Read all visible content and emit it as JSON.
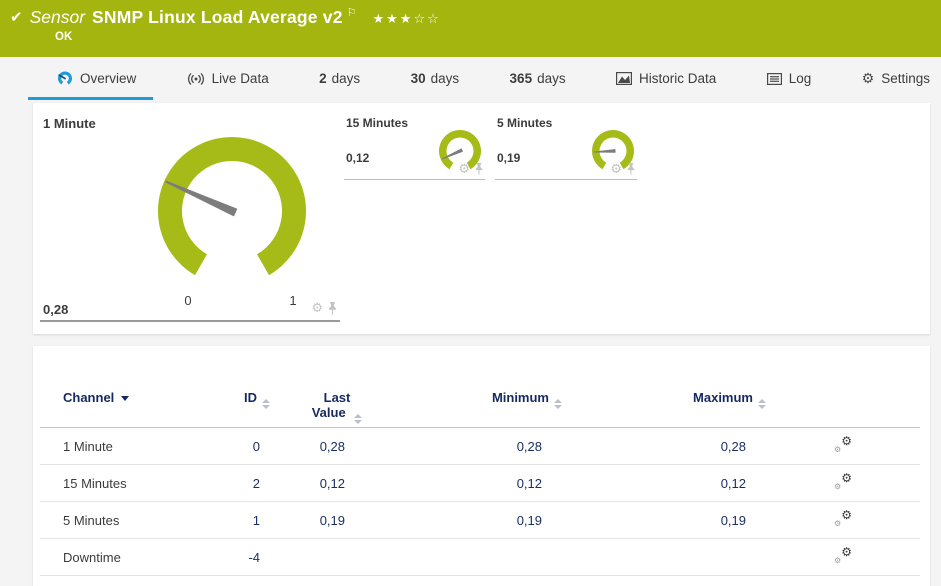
{
  "header": {
    "check_icon": "✔",
    "kind": "Sensor",
    "title": "SNMP Linux Load Average v2",
    "flag_icon": "⚐",
    "stars_filled": "★★★",
    "stars_empty": "☆☆",
    "status": "OK"
  },
  "tabs": {
    "overview": {
      "label": "Overview"
    },
    "live_data": {
      "label": "Live Data"
    },
    "days2": {
      "value": "2",
      "unit": "days"
    },
    "days30": {
      "value": "30",
      "unit": "days"
    },
    "days365": {
      "value": "365",
      "unit": "days"
    },
    "historic": {
      "label": "Historic Data"
    },
    "log": {
      "label": "Log"
    },
    "settings": {
      "label": "Settings"
    }
  },
  "icons": {
    "gear": "⚙"
  },
  "colors": {
    "brand_green": "#a3b50e",
    "gauge_green": "#a6bb17",
    "accent_blue": "#1e9cd9",
    "table_header_navy": "#16295f"
  },
  "gauges": {
    "primary": {
      "title": "1 Minute",
      "value": "0,28",
      "value_num": 0.28,
      "scale_min": "0",
      "scale_max": "1"
    },
    "mini1": {
      "title": "15 Minutes",
      "value": "0,12",
      "value_num": 0.12
    },
    "mini2": {
      "title": "5 Minutes",
      "value": "0,19",
      "value_num": 0.19
    }
  },
  "table": {
    "headers": {
      "channel": "Channel",
      "id": "ID",
      "last_value": "Last Value",
      "minimum": "Minimum",
      "maximum": "Maximum"
    },
    "rows": [
      {
        "channel": "1 Minute",
        "id": "0",
        "last_value": "0,28",
        "minimum": "0,28",
        "maximum": "0,28"
      },
      {
        "channel": "15 Minutes",
        "id": "2",
        "last_value": "0,12",
        "minimum": "0,12",
        "maximum": "0,12"
      },
      {
        "channel": "5 Minutes",
        "id": "1",
        "last_value": "0,19",
        "minimum": "0,19",
        "maximum": "0,19"
      },
      {
        "channel": "Downtime",
        "id": "-4",
        "last_value": "",
        "minimum": "",
        "maximum": ""
      }
    ]
  }
}
